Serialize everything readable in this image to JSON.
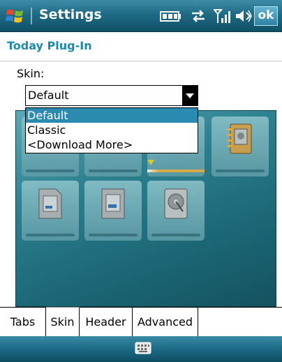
{
  "titlebar": {
    "title": "Settings",
    "ok_label": "ok"
  },
  "page": {
    "heading": "Today Plug-In"
  },
  "skin": {
    "label": "Skin:",
    "selected": "Default",
    "options": [
      "Default",
      "Classic",
      "<Download More>"
    ]
  },
  "tabs": [
    {
      "label": "Tabs"
    },
    {
      "label": "Skin"
    },
    {
      "label": "Header"
    },
    {
      "label": "Advanced"
    }
  ],
  "colors": {
    "accent": "#1c8aa9",
    "selection": "#2b8ab0"
  }
}
